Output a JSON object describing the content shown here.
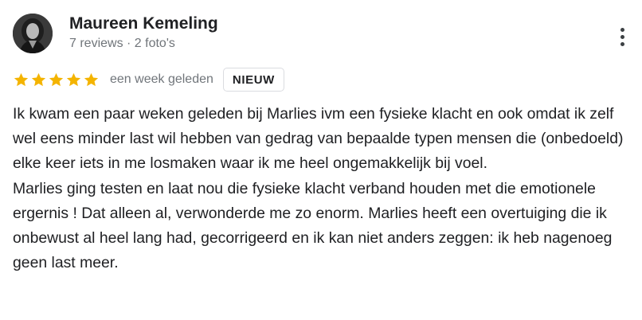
{
  "author": {
    "name": "Maureen Kemeling",
    "meta": "7 reviews · 2 foto's"
  },
  "rating": {
    "stars": 5,
    "max_stars": 5,
    "star_color": "#f4b400",
    "time": "een week geleden",
    "badge": "NIEUW"
  },
  "review": {
    "paragraphs": [
      "Ik kwam een paar weken geleden bij Marlies ivm een fysieke klacht en ook omdat ik zelf wel eens minder last wil hebben van gedrag van bepaalde typen mensen die (onbedoeld) elke keer iets in me losmaken waar ik me heel ongemakkelijk bij voel.",
      "Marlies ging testen en laat nou die fysieke klacht verband houden met die emotionele ergernis ! Dat alleen al, verwonderde me zo enorm. Marlies heeft een overtuiging die ik onbewust al heel lang had, gecorrigeerd en ik kan niet anders zeggen: ik heb nagenoeg geen last meer."
    ]
  },
  "icons": {
    "avatar": "profile-photo",
    "star": "star-icon",
    "more": "more-vert-icon"
  }
}
